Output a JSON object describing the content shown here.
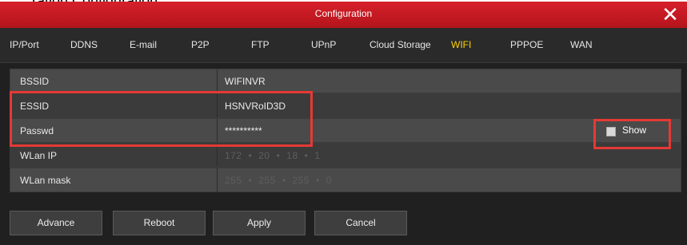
{
  "annotation": {
    "text": "ration Configuration"
  },
  "window": {
    "title": "Configuration",
    "close_glyph": "✕"
  },
  "tabs": [
    {
      "label": "IP/Port",
      "active": false
    },
    {
      "label": "DDNS",
      "active": false
    },
    {
      "label": "E-mail",
      "active": false
    },
    {
      "label": "P2P",
      "active": false
    },
    {
      "label": "FTP",
      "active": false
    },
    {
      "label": "UPnP",
      "active": false
    },
    {
      "label": "Cloud Storage",
      "active": false
    },
    {
      "label": "WIFI",
      "active": true
    },
    {
      "label": "PPPOE",
      "active": false
    },
    {
      "label": "WAN",
      "active": false
    }
  ],
  "form": {
    "bssid": {
      "label": "BSSID",
      "value": "WIFINVR"
    },
    "essid": {
      "label": "ESSID",
      "value": "HSNVRoID3D"
    },
    "passwd": {
      "label": "Passwd",
      "value": "**********",
      "show_label": "Show"
    },
    "wlan_ip": {
      "label": "WLan IP",
      "octets": [
        "172",
        "20",
        "18",
        "1"
      ]
    },
    "wlan_mask": {
      "label": "WLan mask",
      "octets": [
        "255",
        "255",
        "255",
        "0"
      ]
    }
  },
  "buttons": {
    "advance": "Advance",
    "reboot": "Reboot",
    "apply": "Apply",
    "cancel": "Cancel"
  },
  "colors": {
    "title_bar": "#c81a22",
    "active_tab": "#ffd200",
    "highlight": "#e53935"
  }
}
